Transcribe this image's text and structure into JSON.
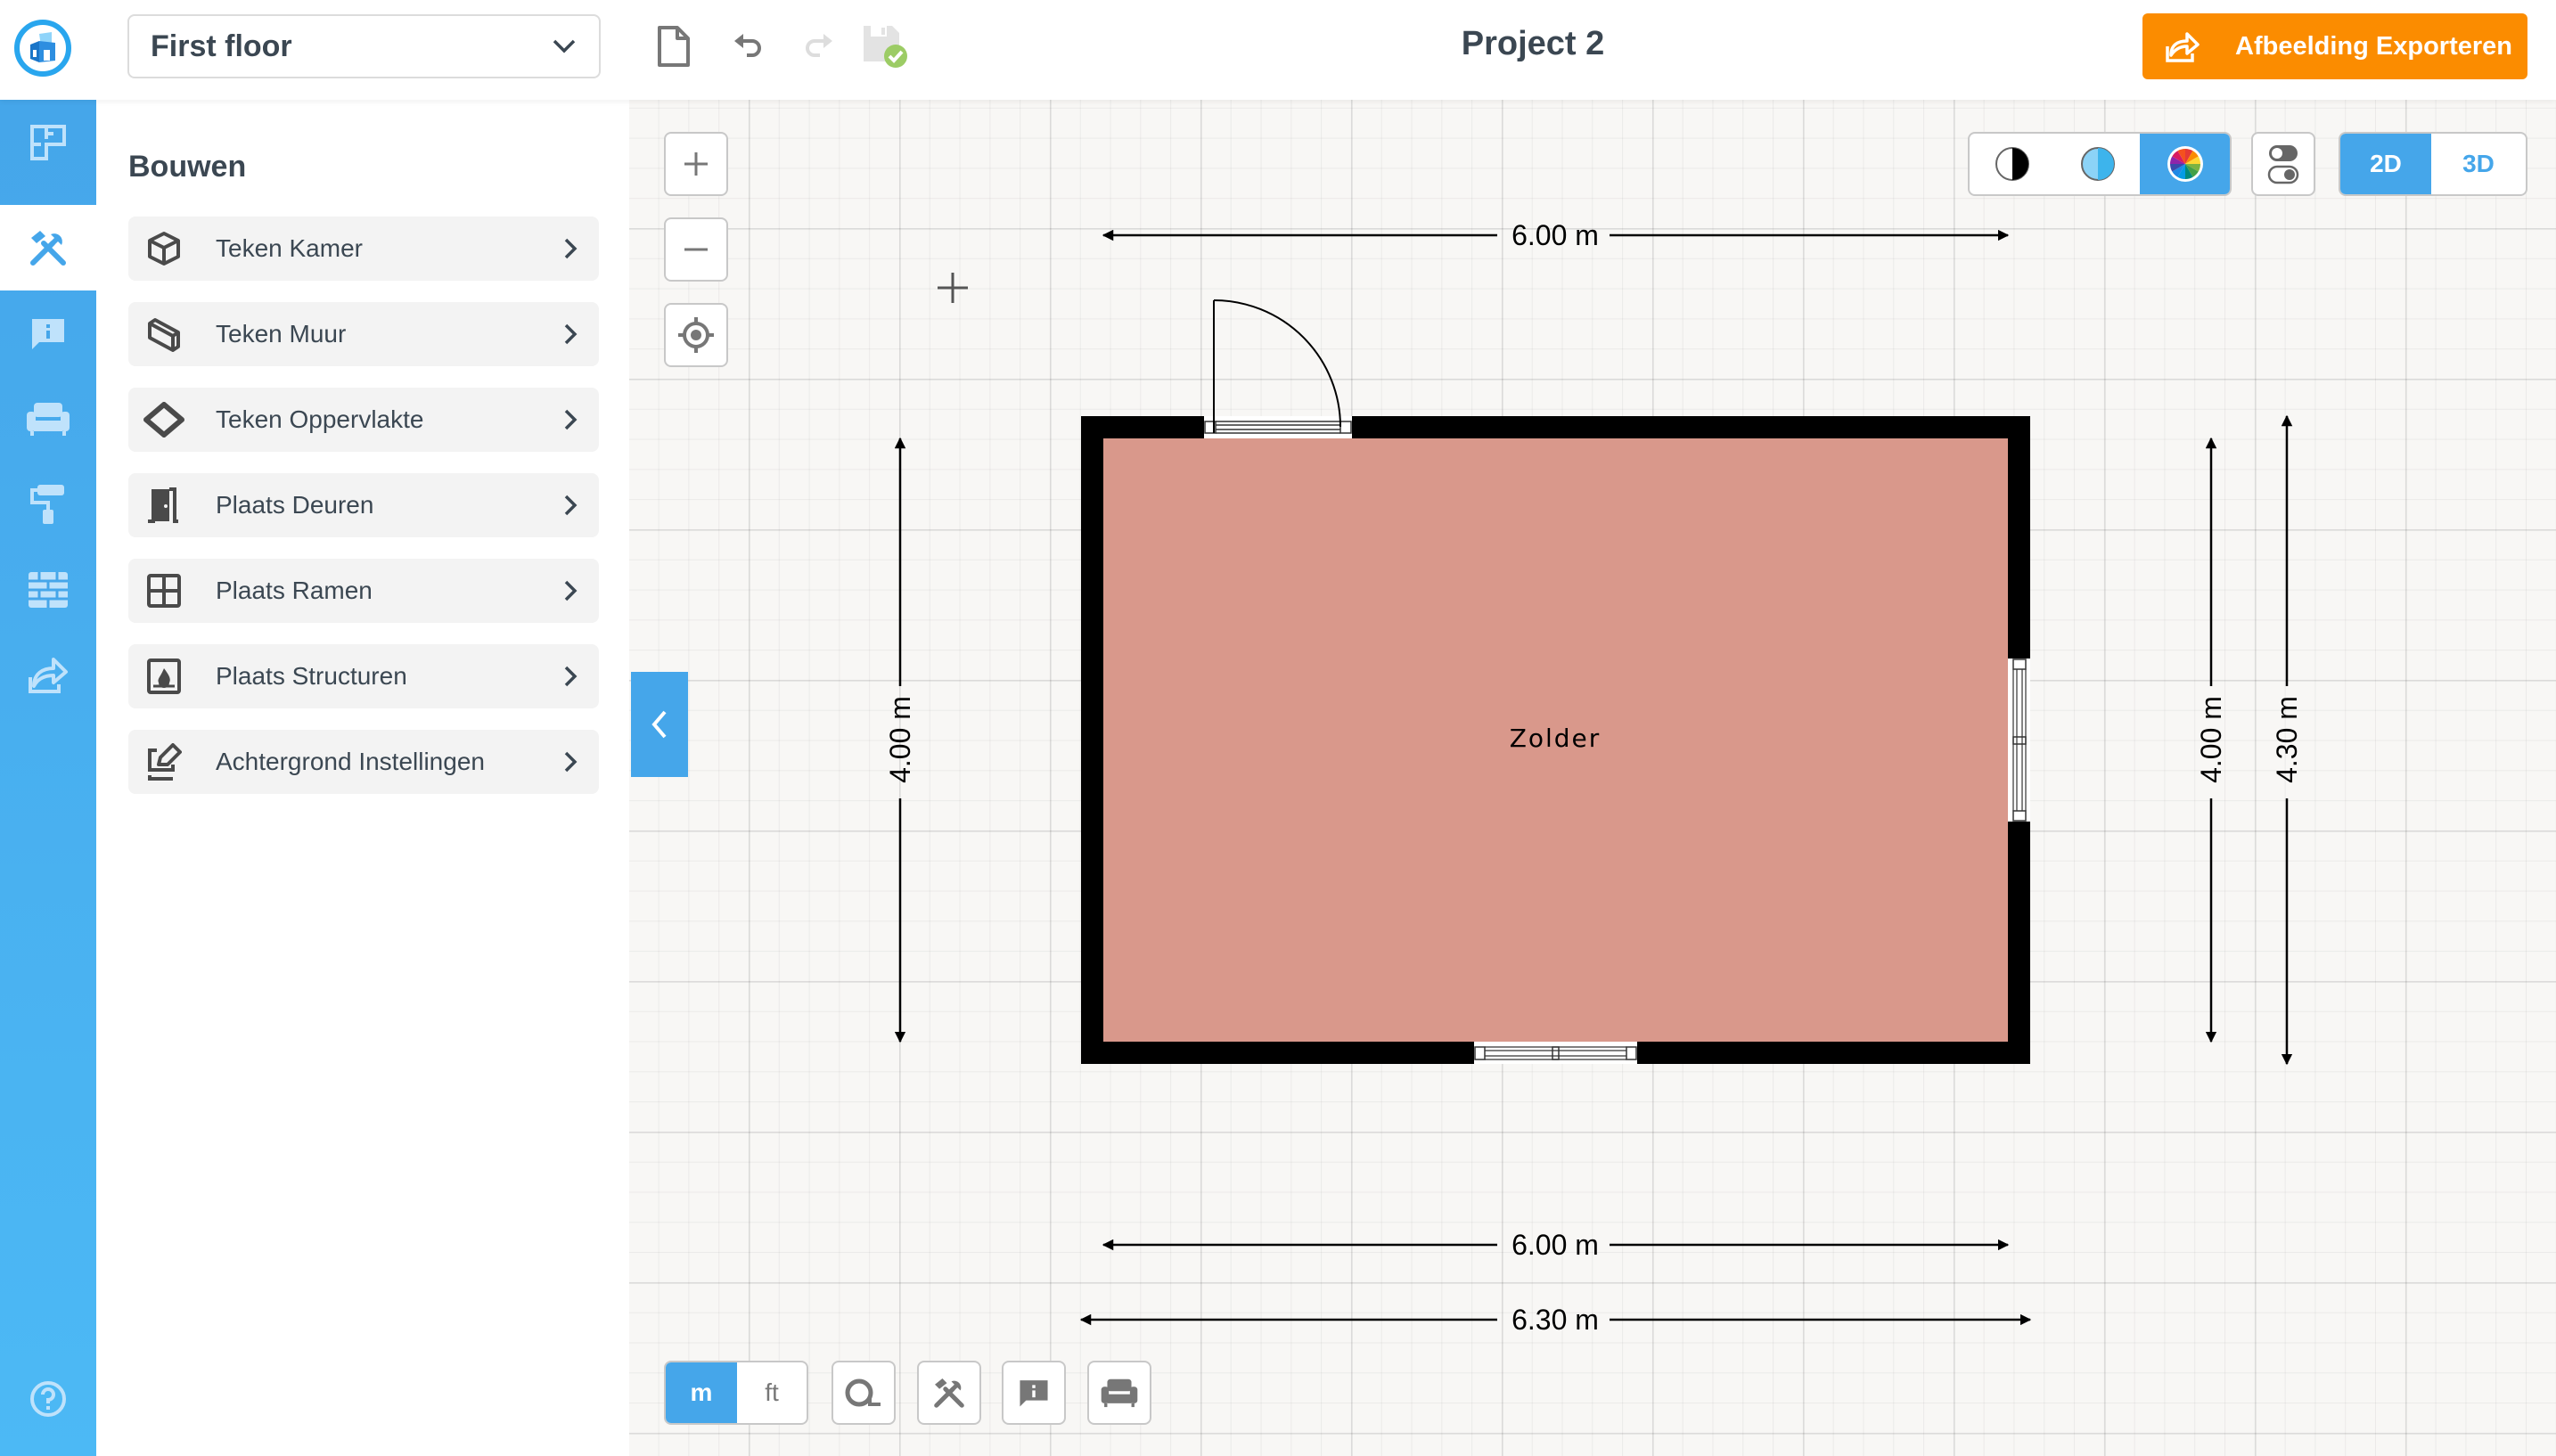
{
  "header": {
    "floor_select": {
      "value": "First floor"
    },
    "project_title": "Project 2",
    "export_button": {
      "label": "Afbeelding Exporteren"
    },
    "toolbar": [
      {
        "name": "new-file",
        "icon": "file-icon"
      },
      {
        "name": "undo",
        "icon": "undo-icon"
      },
      {
        "name": "redo",
        "icon": "redo-icon",
        "disabled": true
      },
      {
        "name": "save",
        "icon": "save-icon",
        "status": "saved"
      }
    ]
  },
  "rail": {
    "items": [
      {
        "name": "floorplan",
        "icon": "floorplan-icon",
        "active": false
      },
      {
        "name": "build",
        "icon": "tools-icon",
        "active": true
      },
      {
        "name": "info",
        "icon": "info-bubble-icon",
        "active": false
      },
      {
        "name": "furniture",
        "icon": "sofa-icon",
        "active": false
      },
      {
        "name": "paint",
        "icon": "paint-roller-icon",
        "active": false
      },
      {
        "name": "materials",
        "icon": "brick-wall-icon",
        "active": false
      },
      {
        "name": "export",
        "icon": "share-icon",
        "active": false
      }
    ],
    "help_icon": "help-icon"
  },
  "panel": {
    "title": "Bouwen",
    "items": [
      {
        "label": "Teken Kamer",
        "icon": "cube-icon"
      },
      {
        "label": "Teken Muur",
        "icon": "wall-block-icon"
      },
      {
        "label": "Teken Oppervlakte",
        "icon": "surface-diamond-icon"
      },
      {
        "label": "Plaats Deuren",
        "icon": "door-icon"
      },
      {
        "label": "Plaats Ramen",
        "icon": "window-icon"
      },
      {
        "label": "Plaats Structuren",
        "icon": "fireplace-icon"
      },
      {
        "label": "Achtergrond Instellingen",
        "icon": "background-edit-icon"
      }
    ]
  },
  "canvas": {
    "zoom_controls": [
      "zoom-in",
      "zoom-out",
      "center"
    ],
    "color_modes": [
      {
        "name": "black-white",
        "active": false
      },
      {
        "name": "blue",
        "active": false
      },
      {
        "name": "color",
        "active": true
      }
    ],
    "view_modes": [
      {
        "label": "2D",
        "active": true
      },
      {
        "label": "3D",
        "active": false
      }
    ],
    "units": [
      {
        "label": "m",
        "active": true
      },
      {
        "label": "ft",
        "active": false
      }
    ],
    "bottom_tools": [
      "measure-tape",
      "tools",
      "info",
      "furniture"
    ],
    "room": {
      "name": "Zolder",
      "width_m": 6.0,
      "depth_m": 4.0,
      "outer_width_m": 6.3,
      "outer_depth_m": 4.3,
      "fill_color": "#d9988b",
      "wall_color": "#000000"
    },
    "dimensions": {
      "top": "6.00 m",
      "bottom_inner": "6.00 m",
      "bottom_outer": "6.30 m",
      "left": "4.00 m",
      "right_inner": "4.00 m",
      "right_outer": "4.30 m"
    }
  },
  "colors": {
    "accent": "#45a6ea",
    "export": "#fb8c00",
    "saved": "#9ccc65"
  }
}
